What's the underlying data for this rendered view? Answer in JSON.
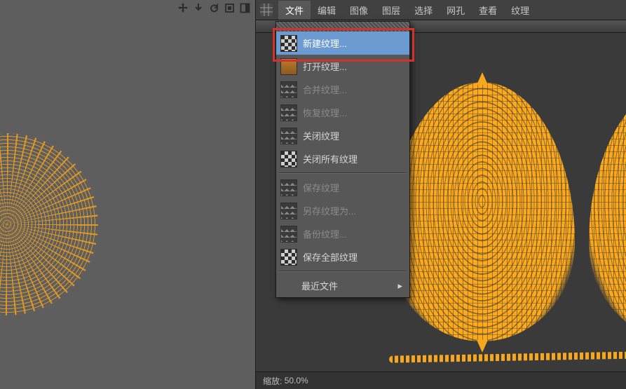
{
  "menubar": {
    "items": [
      "文件",
      "编辑",
      "图像",
      "图层",
      "选择",
      "网孔",
      "查看",
      "纹理"
    ],
    "active_index": 0
  },
  "file_menu": {
    "new_texture": "新建纹理...",
    "open_texture": "打开纹理...",
    "merge_texture": "合并纹理...",
    "restore_texture": "恢复纹理...",
    "close_texture": "关闭纹理",
    "close_all_textures": "关闭所有纹理",
    "save_texture": "保存纹理",
    "save_texture_as": "另存纹理为...",
    "backup_texture": "备份纹理...",
    "save_all_textures": "保存全部纹理",
    "recent_files": "最近文件"
  },
  "status": {
    "zoom_label": "缩放:",
    "zoom_value": "50.0%"
  },
  "left_toolbar_icons": [
    "move-icon",
    "down-arrow-icon",
    "reset-icon",
    "frame-icon",
    "panel-icon"
  ]
}
